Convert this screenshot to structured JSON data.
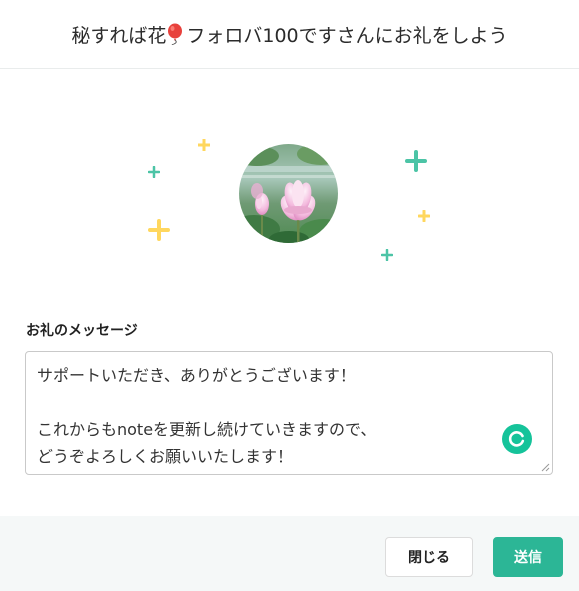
{
  "header": {
    "title_before": "秘すれば花",
    "title_after": "フォロバ100ですさんにお礼をしよう",
    "emoji_icon": "balloon-icon"
  },
  "colors": {
    "accent_green": "#2cb696",
    "sparkle_teal": "#4cc4a6",
    "sparkle_yellow": "#ffd75e",
    "grammarly_green": "#15c39a"
  },
  "message": {
    "label": "お礼のメッセージ",
    "value": "サポートいただき、ありがとうございます！\n\nこれからもnoteを更新し続けていきますので、\nどうぞよろしくお願いいたします！"
  },
  "buttons": {
    "close_label": "閉じる",
    "send_label": "送信"
  }
}
